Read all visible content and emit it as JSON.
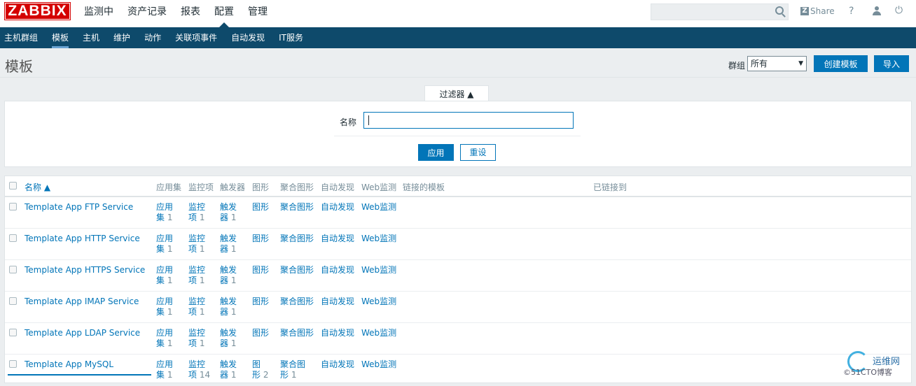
{
  "logo": "ZABBIX",
  "main_menu": [
    "监测中",
    "资产记录",
    "报表",
    "配置",
    "管理"
  ],
  "main_menu_active": 3,
  "share_label": "Share",
  "help_label": "?",
  "power_label": "⏻",
  "sub_menu": [
    "主机群组",
    "模板",
    "主机",
    "维护",
    "动作",
    "关联项事件",
    "自动发现",
    "IT服务"
  ],
  "sub_menu_active": 1,
  "page_title": "模板",
  "group_label": "群组",
  "group_select": "所有",
  "create_button": "创建模板",
  "import_button": "导入",
  "filter_tab": "过滤器 ▲",
  "filter_name_label": "名称",
  "filter_name_value": "",
  "apply_button": "应用",
  "reset_button": "重设",
  "columns": [
    "名称 ▲",
    "应用集",
    "监控项",
    "触发器",
    "图形",
    "聚合图形",
    "自动发现",
    "Web监测",
    "链接的模板",
    "已链接到"
  ],
  "rows": [
    {
      "name": "Template App FTP Service",
      "app": [
        "应用",
        "集",
        "1"
      ],
      "items": [
        "监控",
        "项",
        "1"
      ],
      "triggers": [
        "触发",
        "器",
        "1"
      ],
      "graphs": [
        "图形",
        "",
        ""
      ],
      "screens": [
        "聚合图形",
        "",
        ""
      ],
      "discovery": "自动发现",
      "web": "Web监测"
    },
    {
      "name": "Template App HTTP Service",
      "app": [
        "应用",
        "集",
        "1"
      ],
      "items": [
        "监控",
        "项",
        "1"
      ],
      "triggers": [
        "触发",
        "器",
        "1"
      ],
      "graphs": [
        "图形",
        "",
        ""
      ],
      "screens": [
        "聚合图形",
        "",
        ""
      ],
      "discovery": "自动发现",
      "web": "Web监测"
    },
    {
      "name": "Template App HTTPS Service",
      "app": [
        "应用",
        "集",
        "1"
      ],
      "items": [
        "监控",
        "项",
        "1"
      ],
      "triggers": [
        "触发",
        "器",
        "1"
      ],
      "graphs": [
        "图形",
        "",
        ""
      ],
      "screens": [
        "聚合图形",
        "",
        ""
      ],
      "discovery": "自动发现",
      "web": "Web监测"
    },
    {
      "name": "Template App IMAP Service",
      "app": [
        "应用",
        "集",
        "1"
      ],
      "items": [
        "监控",
        "项",
        "1"
      ],
      "triggers": [
        "触发",
        "器",
        "1"
      ],
      "graphs": [
        "图形",
        "",
        ""
      ],
      "screens": [
        "聚合图形",
        "",
        ""
      ],
      "discovery": "自动发现",
      "web": "Web监测"
    },
    {
      "name": "Template App LDAP Service",
      "app": [
        "应用",
        "集",
        "1"
      ],
      "items": [
        "监控",
        "项",
        "1"
      ],
      "triggers": [
        "触发",
        "器",
        "1"
      ],
      "graphs": [
        "图形",
        "",
        ""
      ],
      "screens": [
        "聚合图形",
        "",
        ""
      ],
      "discovery": "自动发现",
      "web": "Web监测"
    },
    {
      "name": "Template App MySQL",
      "app": [
        "应用",
        "集",
        "1"
      ],
      "items": [
        "监控",
        "项",
        "14"
      ],
      "triggers": [
        "触发",
        "器",
        "1"
      ],
      "graphs": [
        "图",
        "形",
        "2"
      ],
      "screens": [
        "聚合图",
        "形",
        "1"
      ],
      "discovery": "自动发现",
      "web": "Web监测"
    }
  ],
  "watermark": {
    "title": "运维网",
    "subtitle": "©51CTO博客"
  }
}
